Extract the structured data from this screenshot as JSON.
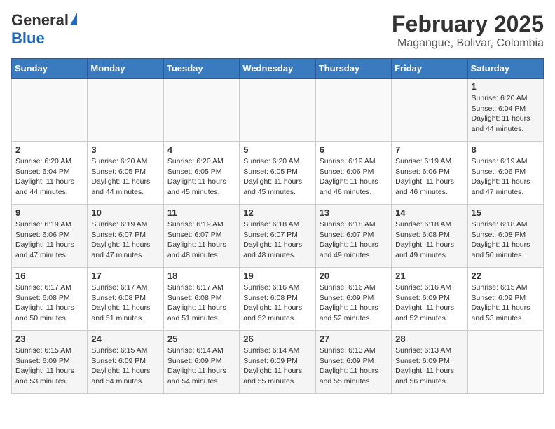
{
  "header": {
    "logo_general": "General",
    "logo_blue": "Blue",
    "month_title": "February 2025",
    "location": "Magangue, Bolivar, Colombia"
  },
  "weekdays": [
    "Sunday",
    "Monday",
    "Tuesday",
    "Wednesday",
    "Thursday",
    "Friday",
    "Saturday"
  ],
  "weeks": [
    [
      {
        "day": "",
        "info": ""
      },
      {
        "day": "",
        "info": ""
      },
      {
        "day": "",
        "info": ""
      },
      {
        "day": "",
        "info": ""
      },
      {
        "day": "",
        "info": ""
      },
      {
        "day": "",
        "info": ""
      },
      {
        "day": "1",
        "info": "Sunrise: 6:20 AM\nSunset: 6:04 PM\nDaylight: 11 hours\nand 44 minutes."
      }
    ],
    [
      {
        "day": "2",
        "info": "Sunrise: 6:20 AM\nSunset: 6:04 PM\nDaylight: 11 hours\nand 44 minutes."
      },
      {
        "day": "3",
        "info": "Sunrise: 6:20 AM\nSunset: 6:05 PM\nDaylight: 11 hours\nand 44 minutes."
      },
      {
        "day": "4",
        "info": "Sunrise: 6:20 AM\nSunset: 6:05 PM\nDaylight: 11 hours\nand 45 minutes."
      },
      {
        "day": "5",
        "info": "Sunrise: 6:20 AM\nSunset: 6:05 PM\nDaylight: 11 hours\nand 45 minutes."
      },
      {
        "day": "6",
        "info": "Sunrise: 6:19 AM\nSunset: 6:06 PM\nDaylight: 11 hours\nand 46 minutes."
      },
      {
        "day": "7",
        "info": "Sunrise: 6:19 AM\nSunset: 6:06 PM\nDaylight: 11 hours\nand 46 minutes."
      },
      {
        "day": "8",
        "info": "Sunrise: 6:19 AM\nSunset: 6:06 PM\nDaylight: 11 hours\nand 47 minutes."
      }
    ],
    [
      {
        "day": "9",
        "info": "Sunrise: 6:19 AM\nSunset: 6:06 PM\nDaylight: 11 hours\nand 47 minutes."
      },
      {
        "day": "10",
        "info": "Sunrise: 6:19 AM\nSunset: 6:07 PM\nDaylight: 11 hours\nand 47 minutes."
      },
      {
        "day": "11",
        "info": "Sunrise: 6:19 AM\nSunset: 6:07 PM\nDaylight: 11 hours\nand 48 minutes."
      },
      {
        "day": "12",
        "info": "Sunrise: 6:18 AM\nSunset: 6:07 PM\nDaylight: 11 hours\nand 48 minutes."
      },
      {
        "day": "13",
        "info": "Sunrise: 6:18 AM\nSunset: 6:07 PM\nDaylight: 11 hours\nand 49 minutes."
      },
      {
        "day": "14",
        "info": "Sunrise: 6:18 AM\nSunset: 6:08 PM\nDaylight: 11 hours\nand 49 minutes."
      },
      {
        "day": "15",
        "info": "Sunrise: 6:18 AM\nSunset: 6:08 PM\nDaylight: 11 hours\nand 50 minutes."
      }
    ],
    [
      {
        "day": "16",
        "info": "Sunrise: 6:17 AM\nSunset: 6:08 PM\nDaylight: 11 hours\nand 50 minutes."
      },
      {
        "day": "17",
        "info": "Sunrise: 6:17 AM\nSunset: 6:08 PM\nDaylight: 11 hours\nand 51 minutes."
      },
      {
        "day": "18",
        "info": "Sunrise: 6:17 AM\nSunset: 6:08 PM\nDaylight: 11 hours\nand 51 minutes."
      },
      {
        "day": "19",
        "info": "Sunrise: 6:16 AM\nSunset: 6:08 PM\nDaylight: 11 hours\nand 52 minutes."
      },
      {
        "day": "20",
        "info": "Sunrise: 6:16 AM\nSunset: 6:09 PM\nDaylight: 11 hours\nand 52 minutes."
      },
      {
        "day": "21",
        "info": "Sunrise: 6:16 AM\nSunset: 6:09 PM\nDaylight: 11 hours\nand 52 minutes."
      },
      {
        "day": "22",
        "info": "Sunrise: 6:15 AM\nSunset: 6:09 PM\nDaylight: 11 hours\nand 53 minutes."
      }
    ],
    [
      {
        "day": "23",
        "info": "Sunrise: 6:15 AM\nSunset: 6:09 PM\nDaylight: 11 hours\nand 53 minutes."
      },
      {
        "day": "24",
        "info": "Sunrise: 6:15 AM\nSunset: 6:09 PM\nDaylight: 11 hours\nand 54 minutes."
      },
      {
        "day": "25",
        "info": "Sunrise: 6:14 AM\nSunset: 6:09 PM\nDaylight: 11 hours\nand 54 minutes."
      },
      {
        "day": "26",
        "info": "Sunrise: 6:14 AM\nSunset: 6:09 PM\nDaylight: 11 hours\nand 55 minutes."
      },
      {
        "day": "27",
        "info": "Sunrise: 6:13 AM\nSunset: 6:09 PM\nDaylight: 11 hours\nand 55 minutes."
      },
      {
        "day": "28",
        "info": "Sunrise: 6:13 AM\nSunset: 6:09 PM\nDaylight: 11 hours\nand 56 minutes."
      },
      {
        "day": "",
        "info": ""
      }
    ]
  ]
}
